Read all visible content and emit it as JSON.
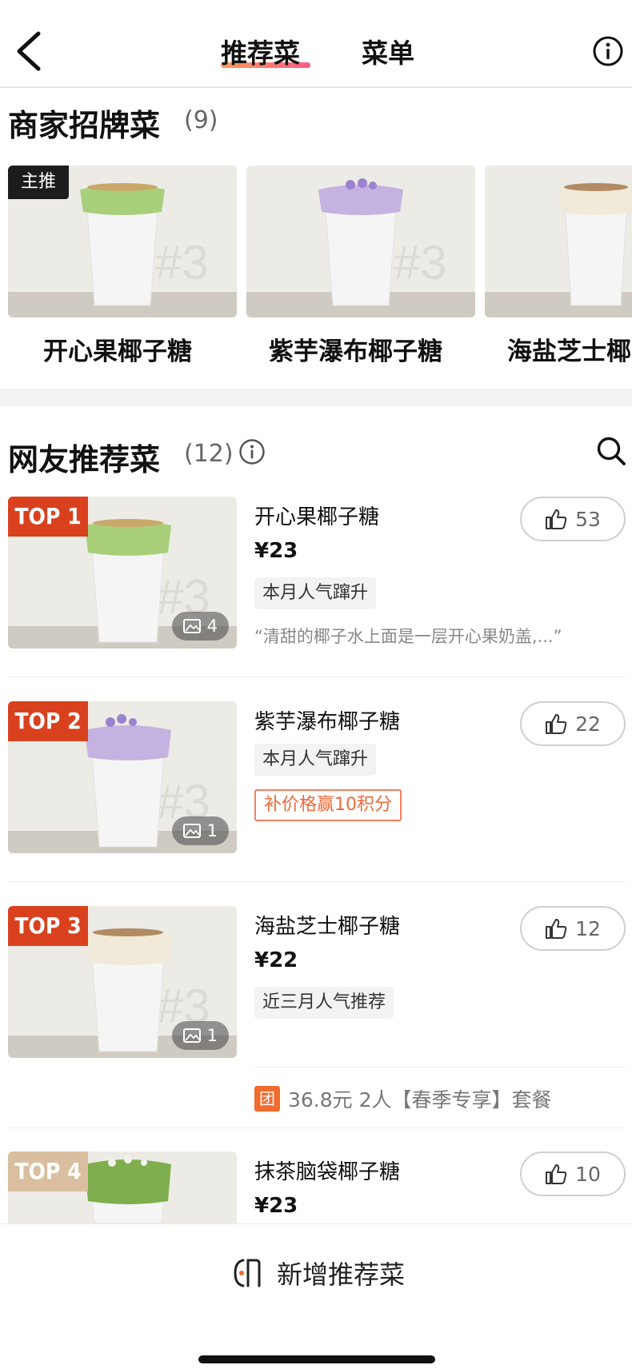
{
  "header": {
    "tabs": [
      {
        "label": "推荐菜",
        "active": true
      },
      {
        "label": "菜单",
        "active": false
      }
    ]
  },
  "signature": {
    "title": "商家招牌菜",
    "count": "(9)",
    "badge": "主推",
    "items": [
      {
        "name": "开心果椰子糖",
        "topping": "#a8cf7a"
      },
      {
        "name": "紫芋瀑布椰子糖",
        "topping": "#c4b2e0"
      },
      {
        "name": "海盐芝士椰",
        "topping": "#f2ead8"
      }
    ]
  },
  "netizen": {
    "title": "网友推荐菜",
    "count": "(12)",
    "dishes": [
      {
        "rank": "TOP 1",
        "name": "开心果椰子糖",
        "price": "¥23",
        "likes": "53",
        "photos": "4",
        "tag": "本月人气蹿升",
        "quote": "“清甜的椰子水上面是一层开心果奶盖,...”"
      },
      {
        "rank": "TOP 2",
        "name": "紫芋瀑布椰子糖",
        "likes": "22",
        "photos": "1",
        "tag": "本月人气蹿升",
        "promo": "补价格赢10积分"
      },
      {
        "rank": "TOP 3",
        "name": "海盐芝士椰子糖",
        "price": "¥22",
        "likes": "12",
        "photos": "1",
        "tag": "近三月人气推荐",
        "deal_icon": "团",
        "deal": "36.8元 2人【春季专享】套餐"
      },
      {
        "rank": "TOP 4",
        "name": "抹茶脑袋椰子糖",
        "price": "¥23",
        "likes": "10"
      }
    ]
  },
  "bottom": {
    "add_label": "新增推荐菜"
  },
  "colors": {
    "accent": "#ee6a3a",
    "top_badge": "#d9411e",
    "top4_badge": "#d9bf9f"
  },
  "icons": [
    "back-arrow-icon",
    "info-icon",
    "search-icon",
    "thumbs-up-icon",
    "image-icon",
    "add-dish-icon"
  ]
}
